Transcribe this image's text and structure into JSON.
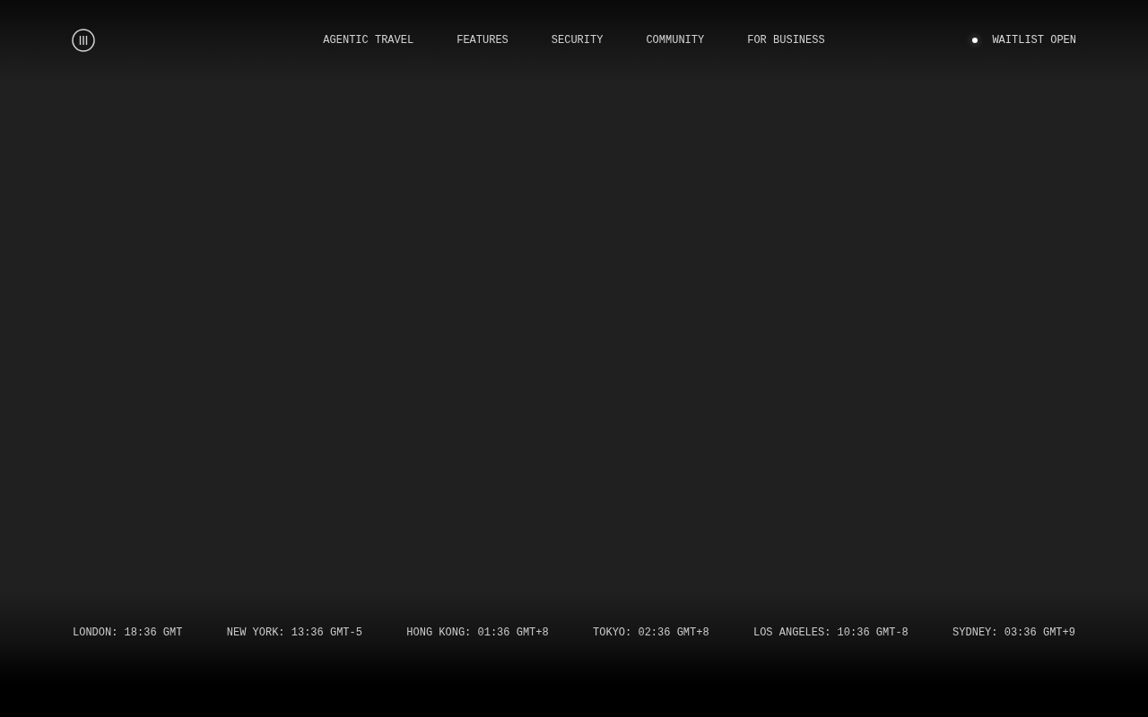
{
  "header": {
    "nav": [
      {
        "label": "AGENTIC TRAVEL"
      },
      {
        "label": "FEATURES"
      },
      {
        "label": "SECURITY"
      },
      {
        "label": "COMMUNITY"
      },
      {
        "label": "FOR BUSINESS"
      }
    ],
    "status": {
      "label": "WAITLIST OPEN"
    }
  },
  "footer": {
    "clocks": [
      "LONDON: 18:36 GMT",
      "NEW YORK: 13:36 GMT-5",
      "HONG KONG: 01:36 GMT+8",
      "TOKYO: 02:36 GMT+8",
      "LOS ANGELES: 10:36 GMT-8",
      "SYDNEY: 03:36 GMT+9"
    ]
  }
}
